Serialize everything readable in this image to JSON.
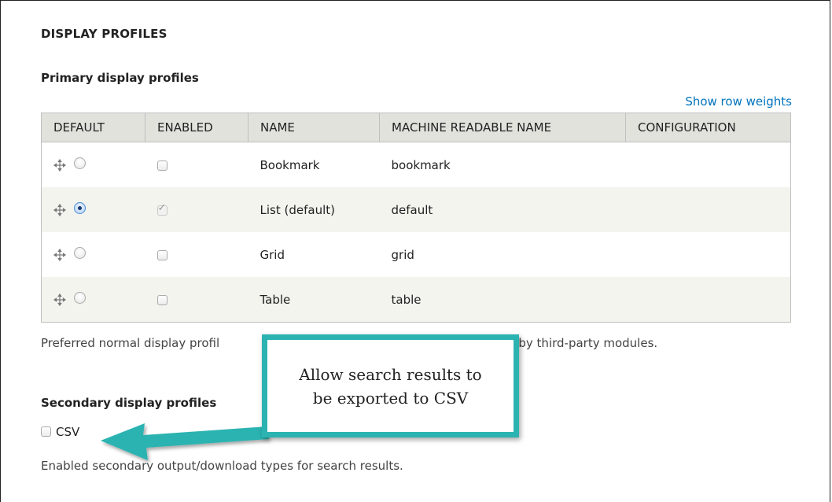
{
  "section_title": "DISPLAY PROFILES",
  "primary": {
    "title": "Primary display profiles",
    "row_weights_link": "Show row weights",
    "columns": [
      "DEFAULT",
      "ENABLED",
      "NAME",
      "MACHINE READABLE NAME",
      "CONFIGURATION"
    ],
    "rows": [
      {
        "default": false,
        "enabled": false,
        "name": "Bookmark",
        "machine": "bookmark",
        "config": ""
      },
      {
        "default": true,
        "enabled": true,
        "name": "List (default)",
        "machine": "default",
        "config": ""
      },
      {
        "default": false,
        "enabled": false,
        "name": "Grid",
        "machine": "grid",
        "config": ""
      },
      {
        "default": false,
        "enabled": false,
        "name": "Table",
        "machine": "table",
        "config": ""
      }
    ],
    "description_left": "Preferred normal display profil",
    "description_right": "ovided by third-party modules."
  },
  "secondary": {
    "title": "Secondary display profiles",
    "csv_label": "CSV",
    "csv_checked": false,
    "description": "Enabled secondary output/download types for search results."
  },
  "callout": {
    "line1": "Allow search results to",
    "line2": "be exported to CSV",
    "border_color": "#2bb3b1"
  }
}
